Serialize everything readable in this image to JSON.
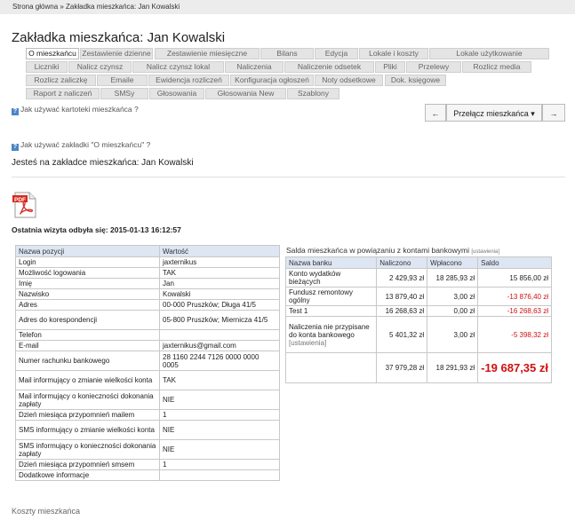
{
  "breadcrumb": "Strona główna » Zakładka mieszkańca: Jan Kowalski",
  "title": "Zakładka mieszkańca: Jan Kowalski",
  "tabs_row1": [
    "O mieszkańcu",
    "Zestawienie dzienne",
    "Zestawienie miesięczne",
    "Bilans",
    "Edycja",
    "Lokale i koszty",
    "Lokale użytkowanie"
  ],
  "tabs_row2": [
    "Liczniki",
    "Nalicz czynsz",
    "Nalicz czynsz lokal",
    "Naliczenia",
    "Naliczenie odsetek",
    "Pliki",
    "Przelewy",
    "Rozlicz media"
  ],
  "tabs_row3": [
    "Rozlicz zaliczkę",
    "Emaile",
    "Ewidencja rozliczeń",
    "Konfiguracja ogłoszeń",
    "Noty odsetkowe",
    "Dok. księgowe"
  ],
  "tabs_row4": [
    "Raport z naliczeń",
    "SMSy",
    "Głosowania",
    "Głosowania New",
    "Szablony"
  ],
  "help1": "Jak używać kartoteki mieszkańca ?",
  "help2": "Jak używać zakładki \"O mieszkańcu\" ?",
  "nav": {
    "prev": "←",
    "switch": "Przełącz mieszkańca ▾",
    "next": "→"
  },
  "info": "Jesteś na zakładce mieszkańca: Jan Kowalski",
  "pdf_label": "PDF",
  "last_visit": "Ostatnia wizyta odbyła się: 2015-01-13 16:12:57",
  "details": {
    "headers": [
      "Nazwa pozycji",
      "Wartość"
    ],
    "rows": [
      [
        "Login",
        "jaxternikus"
      ],
      [
        "Możliwość logowania",
        "TAK"
      ],
      [
        "Imię",
        "Jan"
      ],
      [
        "Nazwisko",
        "Kowalski"
      ],
      [
        "Adres",
        "00-000 Pruszków; Długa 41/5"
      ],
      [
        "Adres do korespondencji",
        "05-800 Pruszków; Miernicza 41/5"
      ],
      [
        "Telefon",
        ""
      ],
      [
        "E-mail",
        "jaxternikus@gmail.com"
      ],
      [
        "Numer rachunku bankowego",
        "28 1160 2244 7126 0000 0000 0005"
      ],
      [
        "Mail informujący o zmianie wielkości konta",
        "TAK"
      ],
      [
        "Mail informujący o konieczności dokonania zapłaty",
        "NIE"
      ],
      [
        "Dzień miesiąca przypomnień mailem",
        "1"
      ],
      [
        "SMS informujący o zmianie wielkości konta",
        "NIE"
      ],
      [
        "SMS informujący o konieczności dokonania zapłaty",
        "NIE"
      ],
      [
        "Dzień miesiąca przypomnień smsem",
        "1"
      ],
      [
        "Dodatkowe informacje",
        ""
      ]
    ]
  },
  "balances": {
    "title": "Salda mieszkańca w powiązaniu z kontami bankowymi",
    "settings": "[ustawienia]",
    "headers": [
      "Nazwa banku",
      "Naliczono",
      "Wpłacono",
      "Saldo"
    ],
    "rows": [
      {
        "name": "Konto wydatków bieżących",
        "charged": "2 429,93 zł",
        "paid": "18 285,93 zł",
        "saldo": "15 856,00 zł",
        "neg": false
      },
      {
        "name": "Fundusz remontowy ogólny",
        "charged": "13 879,40 zł",
        "paid": "3,00 zł",
        "saldo": "-13 876,40 zł",
        "neg": true
      },
      {
        "name": "Test 1",
        "charged": "16 268,63 zł",
        "paid": "0,00 zł",
        "saldo": "-16 268,63 zł",
        "neg": true
      },
      {
        "name": "Naliczenia nie przypisane do konta bankowego",
        "charged": "5 401,32 zł",
        "paid": "3,00 zł",
        "saldo": "-5 398,32 zł",
        "neg": true
      }
    ],
    "row_settings": "[ustawienia]",
    "total": {
      "charged": "37 979,28 zł",
      "paid": "18 291,93 zł",
      "saldo": "-19 687,35 zł"
    }
  },
  "footer": "Koszty mieszkańca",
  "colors": {
    "accent": "#4a86c5",
    "negative": "#d01010",
    "header_bg": "#dde6f2"
  }
}
